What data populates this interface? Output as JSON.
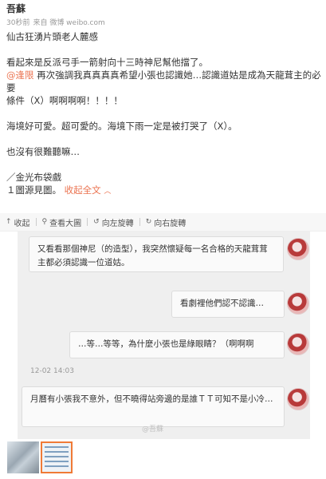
{
  "post": {
    "author": "吾蘇",
    "time": "30秒前",
    "source": "来自 微博 weibo.com",
    "line1": "仙古狂湧片頭老人麓感",
    "line2": "看起來是反派弓手一箭射向十三時神尼幫他擋了。",
    "mention": "@逢限",
    "line3_rest": " 再次強調我真真真真希望小張也認識她…認識道姑是成為天龍茸主的必要",
    "line4": "條件（X）啊啊啊啊！！！！",
    "line5": "海境好可愛。超可愛的。海境下雨一定是被打哭了（X）。",
    "line6": "也沒有很難聽嘛…",
    "line7": "／金光布袋戲",
    "line8_prefix": "１圖源見圖。",
    "expand_label": "收起全文",
    "expand_icon": "chevron-up-icon"
  },
  "toolbar": {
    "collapse_label": "收起",
    "view_large_label": "查看大圖",
    "rotate_left_label": "向左旋轉",
    "rotate_right_label": "向右旋轉"
  },
  "chat": {
    "messages": [
      {
        "side": "left",
        "text": "又看看那個神尼（的造型），我突然懷疑每一名合格的天龍茸茸主都必須認識一位道姑。"
      },
      {
        "side": "right",
        "text": "看劇裡他們認不認識…"
      },
      {
        "side": "right",
        "text": "…等…等等，為什麼小張也是綠眼睛？（啊啊啊"
      },
      {
        "side": "left",
        "text": "月曆有小張我不意外，但不曉得站旁邊的是誰ＴＴ可知不是小冷…"
      }
    ],
    "timestamp": "12-02 14:03",
    "watermark": "@吾蘇"
  }
}
